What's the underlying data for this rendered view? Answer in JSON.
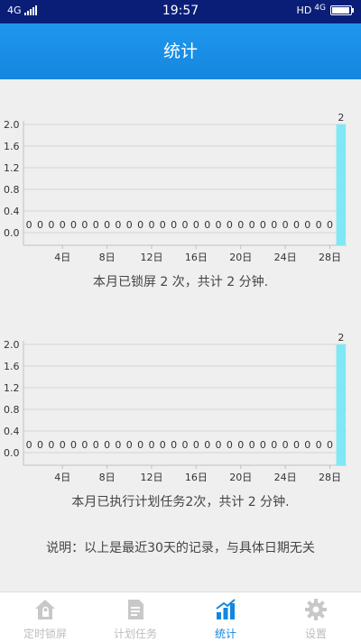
{
  "status_bar": {
    "network_left": "4G",
    "time": "19:57",
    "hd": "HD",
    "network_right": "4G"
  },
  "header": {
    "title": "统计"
  },
  "chart1": {
    "caption": "本月已锁屏 2 次，共计 2 分钟."
  },
  "chart2": {
    "caption": "本月已执行计划任务2次，共计 2 分钟."
  },
  "note": "说明：以上是最近30天的记录，与具体日期无关",
  "chart_data": [
    {
      "type": "bar",
      "x": [
        1,
        2,
        3,
        4,
        5,
        6,
        7,
        8,
        9,
        10,
        11,
        12,
        13,
        14,
        15,
        16,
        17,
        18,
        19,
        20,
        21,
        22,
        23,
        24,
        25,
        26,
        27,
        28,
        29
      ],
      "values": [
        0,
        0,
        0,
        0,
        0,
        0,
        0,
        0,
        0,
        0,
        0,
        0,
        0,
        0,
        0,
        0,
        0,
        0,
        0,
        0,
        0,
        0,
        0,
        0,
        0,
        0,
        0,
        0,
        2
      ],
      "x_ticks": [
        "4日",
        "8日",
        "12日",
        "16日",
        "20日",
        "24日",
        "28日"
      ],
      "x_tick_positions": [
        4,
        8,
        12,
        16,
        20,
        24,
        28
      ],
      "y_ticks": [
        "0.0",
        "0.4",
        "0.8",
        "1.2",
        "1.6",
        "2.0"
      ],
      "ylim": [
        0,
        2
      ],
      "bar_color": "#80e8f5",
      "grid": true
    },
    {
      "type": "bar",
      "x": [
        1,
        2,
        3,
        4,
        5,
        6,
        7,
        8,
        9,
        10,
        11,
        12,
        13,
        14,
        15,
        16,
        17,
        18,
        19,
        20,
        21,
        22,
        23,
        24,
        25,
        26,
        27,
        28,
        29
      ],
      "values": [
        0,
        0,
        0,
        0,
        0,
        0,
        0,
        0,
        0,
        0,
        0,
        0,
        0,
        0,
        0,
        0,
        0,
        0,
        0,
        0,
        0,
        0,
        0,
        0,
        0,
        0,
        0,
        0,
        2
      ],
      "x_ticks": [
        "4日",
        "8日",
        "12日",
        "16日",
        "20日",
        "24日",
        "28日"
      ],
      "x_tick_positions": [
        4,
        8,
        12,
        16,
        20,
        24,
        28
      ],
      "y_ticks": [
        "0.0",
        "0.4",
        "0.8",
        "1.2",
        "1.6",
        "2.0"
      ],
      "ylim": [
        0,
        2
      ],
      "bar_color": "#80e8f5",
      "grid": true
    }
  ],
  "tabs": [
    {
      "label": "定时锁屏",
      "icon": "home-lock-icon",
      "active": false
    },
    {
      "label": "计划任务",
      "icon": "document-icon",
      "active": false
    },
    {
      "label": "统计",
      "icon": "bar-chart-icon",
      "active": true
    },
    {
      "label": "设置",
      "icon": "gear-icon",
      "active": false
    }
  ],
  "colors": {
    "accent": "#1586df",
    "header": "#1f97ee",
    "status_bar": "#0a1e78"
  }
}
